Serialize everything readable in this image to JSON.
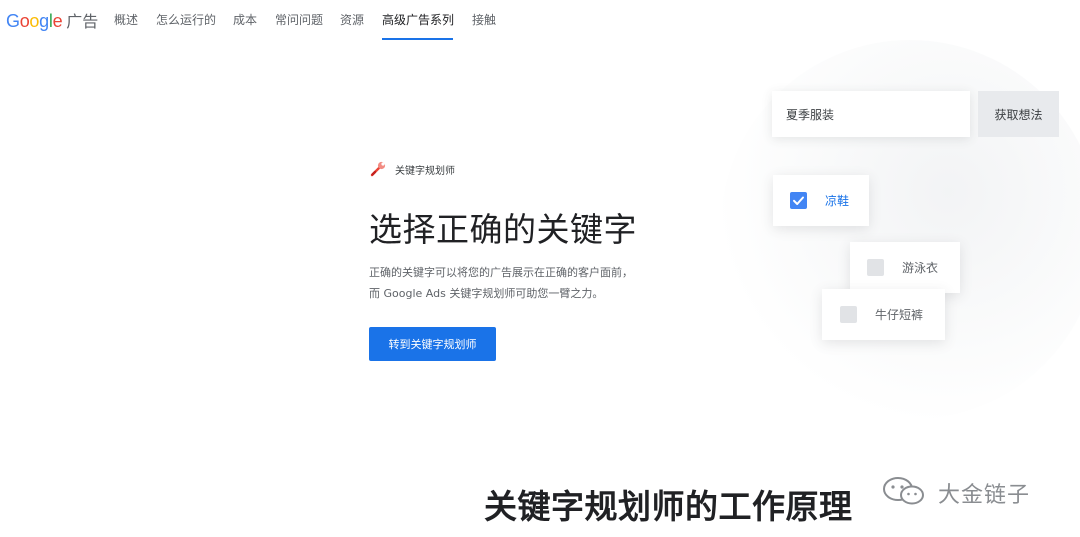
{
  "brand": {
    "logo_letters": [
      {
        "ch": "G",
        "color": "#4285F4"
      },
      {
        "ch": "o",
        "color": "#EA4335"
      },
      {
        "ch": "o",
        "color": "#FBBC05"
      },
      {
        "ch": "g",
        "color": "#4285F4"
      },
      {
        "ch": "l",
        "color": "#34A853"
      },
      {
        "ch": "e",
        "color": "#EA4335"
      }
    ],
    "product": "广告"
  },
  "nav": {
    "items": [
      {
        "label": "概述"
      },
      {
        "label": "怎么运行的"
      },
      {
        "label": "成本"
      },
      {
        "label": "常问问题"
      },
      {
        "label": "资源"
      },
      {
        "label": "高级广告系列",
        "active": true
      },
      {
        "label": "接触"
      }
    ]
  },
  "hero": {
    "tool_label": "关键字规划师",
    "tool_icon": "wrench-icon",
    "title": "选择正确的关键字",
    "desc_line1": "正确的关键字可以将您的广告展示在正确的客户面前，",
    "desc_line2": "而 Google Ads 关键字规划师可助您一臂之力。",
    "cta_label": "转到关键字规划师"
  },
  "illustration": {
    "search_value": "夏季服装",
    "get_ideas_label": "获取想法",
    "keywords": [
      {
        "label": "凉鞋",
        "checked": true
      },
      {
        "label": "游泳衣",
        "checked": false
      },
      {
        "label": "牛仔短裤",
        "checked": false
      }
    ]
  },
  "section": {
    "title": "关键字规划师的工作原理"
  },
  "watermark": {
    "text": "大金链子",
    "icon": "wechat-icon"
  },
  "colors": {
    "accent": "#1a73e8",
    "checkbox_checked": "#4285f4",
    "checkbox_unchecked": "#e1e3e6"
  }
}
